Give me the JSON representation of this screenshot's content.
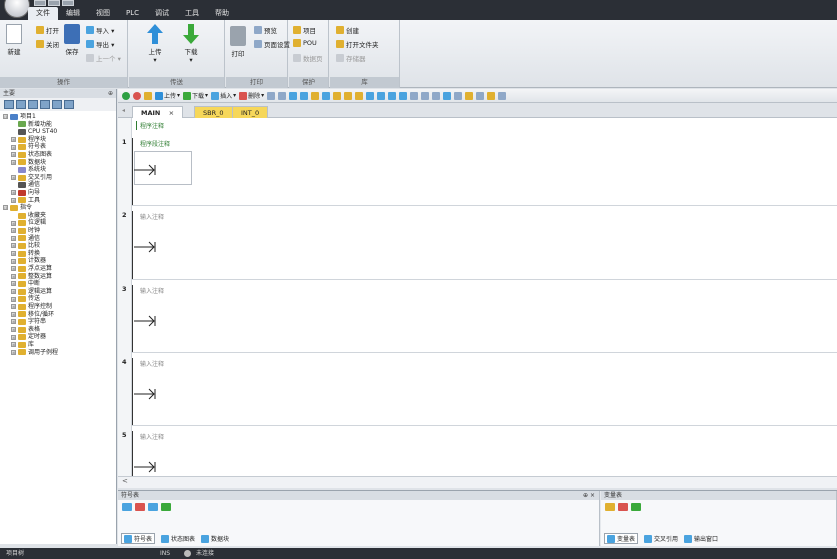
{
  "menu": {
    "items": [
      "文件",
      "编辑",
      "视图",
      "PLC",
      "调试",
      "工具",
      "帮助"
    ]
  },
  "ribbon": {
    "groups": [
      {
        "label": "操作",
        "buttons": {
          "new": "新建",
          "open": "打开",
          "close": "关闭",
          "save": "保存",
          "import": "导入 ▾",
          "export": "导出 ▾",
          "up_one": "上一个 ▾"
        }
      },
      {
        "label": "传送",
        "buttons": {
          "upload": "上传",
          "download": "下载"
        }
      },
      {
        "label": "打印",
        "buttons": {
          "print": "打印",
          "preview": "预览",
          "page_setup": "页面设置"
        }
      },
      {
        "label": "保护",
        "buttons": {
          "project": "项目",
          "pou": "POU",
          "data_page": "数据页"
        }
      },
      {
        "label": "库",
        "buttons": {
          "create": "创建",
          "open_folder": "打开文件夹",
          "memory": "存储器"
        }
      }
    ]
  },
  "left_panel": {
    "title": "主要",
    "pin": "⊕",
    "tree": [
      {
        "label": "项目1",
        "level": 0,
        "exp": "⊟",
        "color": "#4a80c8"
      },
      {
        "label": "新增功能",
        "level": 1,
        "exp": "",
        "color": "#6aa84f"
      },
      {
        "label": "CPU ST40",
        "level": 1,
        "exp": "",
        "color": "#555555"
      },
      {
        "label": "程序块",
        "level": 1,
        "exp": "⊞",
        "color": "#e0b030"
      },
      {
        "label": "符号表",
        "level": 1,
        "exp": "⊞",
        "color": "#e0b030"
      },
      {
        "label": "状态图表",
        "level": 1,
        "exp": "⊞",
        "color": "#e0b030"
      },
      {
        "label": "数据块",
        "level": 1,
        "exp": "⊞",
        "color": "#e0b030"
      },
      {
        "label": "系统块",
        "level": 1,
        "exp": "",
        "color": "#8888cc"
      },
      {
        "label": "交叉引用",
        "level": 1,
        "exp": "⊞",
        "color": "#e0b030"
      },
      {
        "label": "通信",
        "level": 1,
        "exp": "",
        "color": "#555555"
      },
      {
        "label": "向导",
        "level": 1,
        "exp": "⊞",
        "color": "#c0392b"
      },
      {
        "label": "工具",
        "level": 1,
        "exp": "⊞",
        "color": "#e0b030"
      },
      {
        "label": "指令",
        "level": 0,
        "exp": "⊟",
        "color": "#e0b030"
      },
      {
        "label": "收藏夹",
        "level": 1,
        "exp": "",
        "color": "#e0b030"
      },
      {
        "label": "位逻辑",
        "level": 1,
        "exp": "⊞",
        "color": "#e0b030"
      },
      {
        "label": "时钟",
        "level": 1,
        "exp": "⊞",
        "color": "#e0b030"
      },
      {
        "label": "通信",
        "level": 1,
        "exp": "⊞",
        "color": "#e0b030"
      },
      {
        "label": "比较",
        "level": 1,
        "exp": "⊞",
        "color": "#e0b030"
      },
      {
        "label": "转换",
        "level": 1,
        "exp": "⊞",
        "color": "#e0b030"
      },
      {
        "label": "计数器",
        "level": 1,
        "exp": "⊞",
        "color": "#e0b030"
      },
      {
        "label": "浮点运算",
        "level": 1,
        "exp": "⊞",
        "color": "#e0b030"
      },
      {
        "label": "整数运算",
        "level": 1,
        "exp": "⊞",
        "color": "#e0b030"
      },
      {
        "label": "中断",
        "level": 1,
        "exp": "⊞",
        "color": "#e0b030"
      },
      {
        "label": "逻辑运算",
        "level": 1,
        "exp": "⊞",
        "color": "#e0b030"
      },
      {
        "label": "传送",
        "level": 1,
        "exp": "⊞",
        "color": "#e0b030"
      },
      {
        "label": "程序控制",
        "level": 1,
        "exp": "⊞",
        "color": "#e0b030"
      },
      {
        "label": "移位/循环",
        "level": 1,
        "exp": "⊞",
        "color": "#e0b030"
      },
      {
        "label": "字符串",
        "level": 1,
        "exp": "⊞",
        "color": "#e0b030"
      },
      {
        "label": "表格",
        "level": 1,
        "exp": "⊞",
        "color": "#e0b030"
      },
      {
        "label": "定时器",
        "level": 1,
        "exp": "⊞",
        "color": "#e0b030"
      },
      {
        "label": "库",
        "level": 1,
        "exp": "⊞",
        "color": "#e0b030"
      },
      {
        "label": "调用子例程",
        "level": 1,
        "exp": "⊞",
        "color": "#e0b030"
      }
    ]
  },
  "editor_toolbar": {
    "upload": "上传",
    "download": "下载",
    "insert": "插入",
    "delete": "删除",
    "tab_prefix": "◂"
  },
  "tabs": [
    {
      "label": "MAIN",
      "close": "×"
    },
    {
      "label": "SBR_0"
    },
    {
      "label": "INT_0"
    }
  ],
  "ladder": {
    "program_comment": "程序注释",
    "networks": [
      {
        "num": "1",
        "comment": "程序段注释"
      },
      {
        "num": "2",
        "comment": "输入注释"
      },
      {
        "num": "3",
        "comment": "输入注释"
      },
      {
        "num": "4",
        "comment": "输入注释"
      },
      {
        "num": "5",
        "comment": "输入注释"
      }
    ],
    "scroll_left": "<"
  },
  "bottom": {
    "symbol_panel": {
      "title": "符号表",
      "pin": "⊕ ×",
      "tabs": [
        "符号表",
        "状态图表",
        "数据块"
      ]
    },
    "var_panel": {
      "title": "变量表",
      "tabs": [
        "变量表",
        "交叉引用",
        "输出窗口"
      ]
    }
  },
  "status": {
    "left": "项目树",
    "mode": "INS",
    "conn": "未连接"
  }
}
